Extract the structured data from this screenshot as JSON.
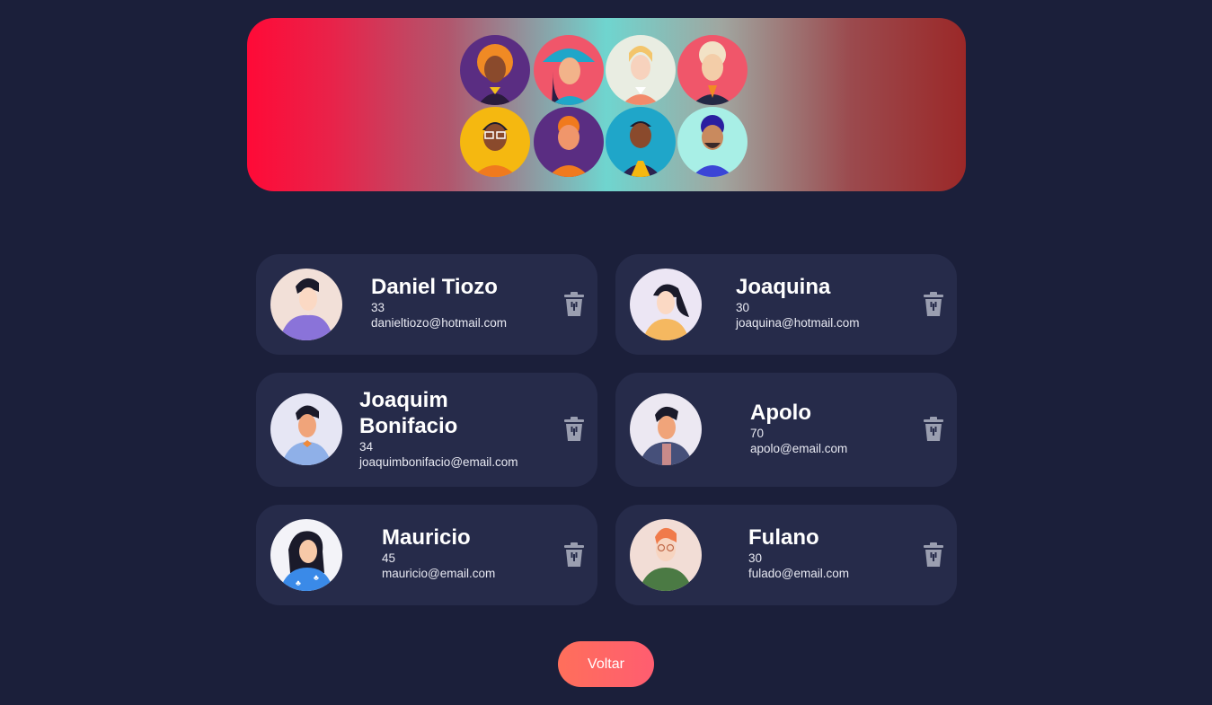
{
  "banner": {
    "avatars": [
      "avatar-1",
      "avatar-2",
      "avatar-3",
      "avatar-4",
      "avatar-5",
      "avatar-6",
      "avatar-7",
      "avatar-8"
    ]
  },
  "users": [
    {
      "name": "Daniel Tiozo",
      "age": "33",
      "email": "danieltiozo@hotmail.com"
    },
    {
      "name": "Joaquina",
      "age": "30",
      "email": "joaquina@hotmail.com"
    },
    {
      "name": "Joaquim Bonifacio",
      "age": "34",
      "email": "joaquimbonifacio@email.com"
    },
    {
      "name": "Apolo",
      "age": "70",
      "email": "apolo@email.com"
    },
    {
      "name": "Mauricio",
      "age": "45",
      "email": "mauricio@email.com"
    },
    {
      "name": "Fulano",
      "age": "30",
      "email": "fulado@email.com"
    }
  ],
  "icons": {
    "delete": "trash-icon"
  },
  "back_button": {
    "label": "Voltar"
  },
  "colors": {
    "background": "#1b1f3a",
    "card": "#262b4a",
    "button_start": "#ff6f5b",
    "button_end": "#ff5d70"
  }
}
